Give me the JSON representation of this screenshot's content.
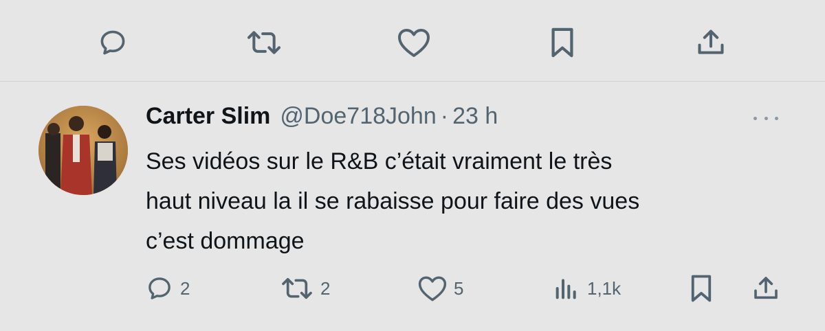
{
  "top_actions": {
    "icons": [
      "reply-icon",
      "retweet-icon",
      "like-icon",
      "bookmark-icon",
      "share-icon"
    ]
  },
  "tweet": {
    "author_name": "Carter Slim",
    "handle": "@Doe718John",
    "separator": "·",
    "time": "23 h",
    "lines": [
      "Ses vidéos sur le R&B c’était vraiment le très",
      "haut niveau la il se rabaisse pour faire des vues",
      "c’est dommage"
    ],
    "stats": {
      "replies": "2",
      "retweets": "2",
      "likes": "5",
      "views": "1,1k"
    }
  },
  "colors": {
    "background": "#e6e6e6",
    "icon": "#536471",
    "text": "#0f1419",
    "secondary_text": "#536471"
  }
}
